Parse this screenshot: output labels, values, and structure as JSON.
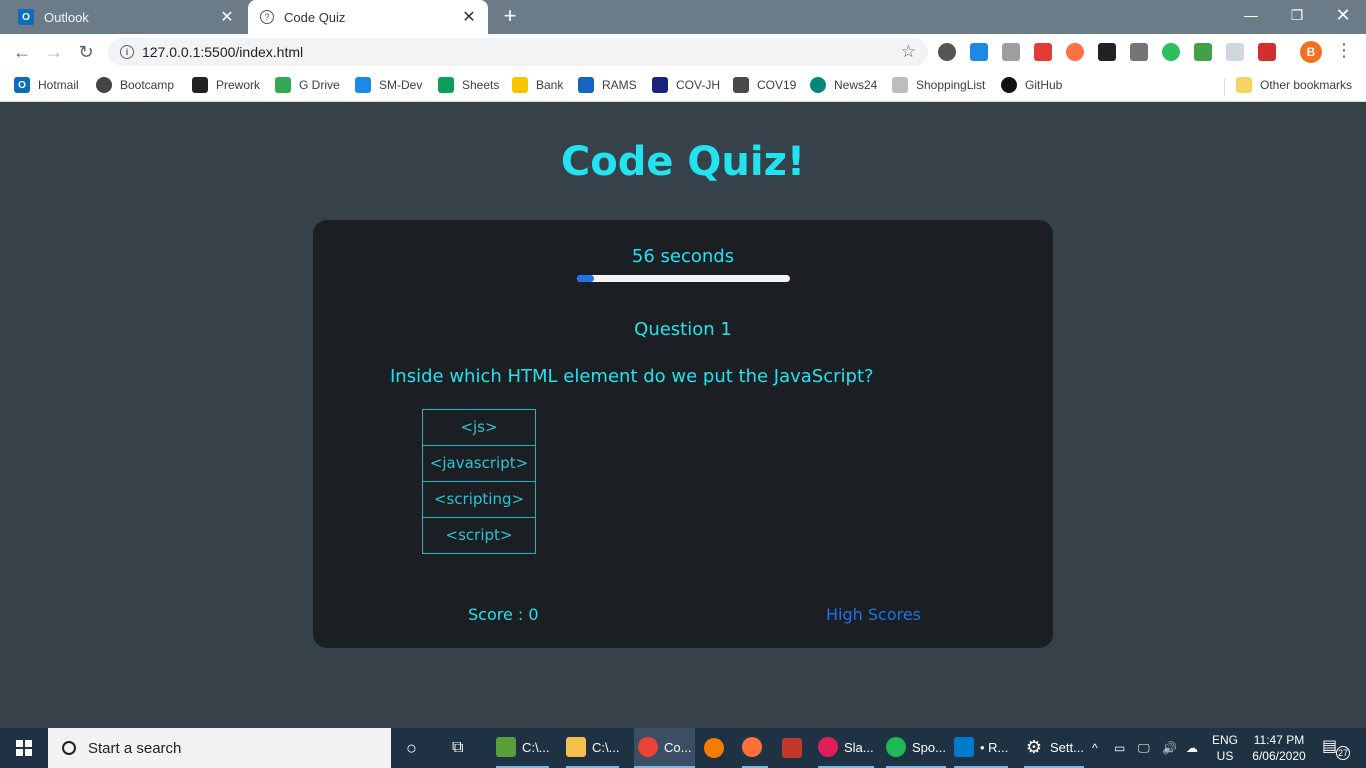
{
  "browser": {
    "tabs": [
      {
        "title": "Outlook",
        "active": false,
        "icon": "outlook-icon"
      },
      {
        "title": "Code Quiz",
        "active": true,
        "icon": "globe-icon"
      }
    ],
    "url": "127.0.0.1:5500/index.html",
    "profile_initial": "B",
    "bookmarks": [
      {
        "label": "Hotmail",
        "icon": "outlook-icon",
        "color": "#0f6cbd"
      },
      {
        "label": "Bootcamp",
        "icon": "globe-icon",
        "color": "#444444"
      },
      {
        "label": "Prework",
        "icon": "book-icon",
        "color": "#222222"
      },
      {
        "label": "G Drive",
        "icon": "drive-icon",
        "color": "#34a853"
      },
      {
        "label": "SM-Dev",
        "icon": "sm-icon",
        "color": "#1e88e5"
      },
      {
        "label": "Sheets",
        "icon": "sheets-icon",
        "color": "#0f9d58"
      },
      {
        "label": "Bank",
        "icon": "diamond-icon",
        "color": "#f7c600"
      },
      {
        "label": "RAMS",
        "icon": "rams-icon",
        "color": "#1565c0"
      },
      {
        "label": "COV-JH",
        "icon": "shield-icon",
        "color": "#1a237e"
      },
      {
        "label": "COV19",
        "icon": "grid-icon",
        "color": "#4a4a4a"
      },
      {
        "label": "News24",
        "icon": "news-icon",
        "color": "#00897b"
      },
      {
        "label": "ShoppingList",
        "icon": "list-icon",
        "color": "#bdbdbd"
      },
      {
        "label": "GitHub",
        "icon": "github-icon",
        "color": "#111111"
      }
    ],
    "other_bookmarks": "Other bookmarks"
  },
  "quiz": {
    "title": "Code Quiz!",
    "timer_text": "56 seconds",
    "timer_progress": 0.08,
    "question_label": "Question 1",
    "question_text": "Inside which HTML element do we put the JavaScript?",
    "answers": [
      "<js>",
      "<javascript>",
      "<scripting>",
      "<script>"
    ],
    "score_text": "Score : 0",
    "high_scores_label": "High Scores"
  },
  "taskbar": {
    "search_placeholder": "Start a search",
    "apps": [
      {
        "label": "C:\\...",
        "icon": "image-app-icon",
        "color": "#5a9e3a"
      },
      {
        "label": "C:\\...",
        "icon": "folder-icon",
        "color": "#f2c14e"
      },
      {
        "label": "Co...",
        "icon": "chrome-icon",
        "color": "#ea4335"
      },
      {
        "label": "",
        "icon": "search-app-icon",
        "color": "#f57c00"
      },
      {
        "label": "",
        "icon": "firefox-icon",
        "color": "#ff7139"
      },
      {
        "label": "",
        "icon": "window-app-icon",
        "color": "#c0392b"
      },
      {
        "label": "Sla...",
        "icon": "slack-icon",
        "color": "#e01e5a"
      },
      {
        "label": "Spo...",
        "icon": "spotify-icon",
        "color": "#1db954"
      },
      {
        "label": "• R...",
        "icon": "vscode-icon",
        "color": "#007acc"
      },
      {
        "label": "Sett...",
        "icon": "gear-icon",
        "color": "#ffffff"
      }
    ],
    "lang_line1": "ENG",
    "lang_line2": "US",
    "time": "11:47 PM",
    "date": "6/06/2020",
    "notification_count": "27"
  }
}
